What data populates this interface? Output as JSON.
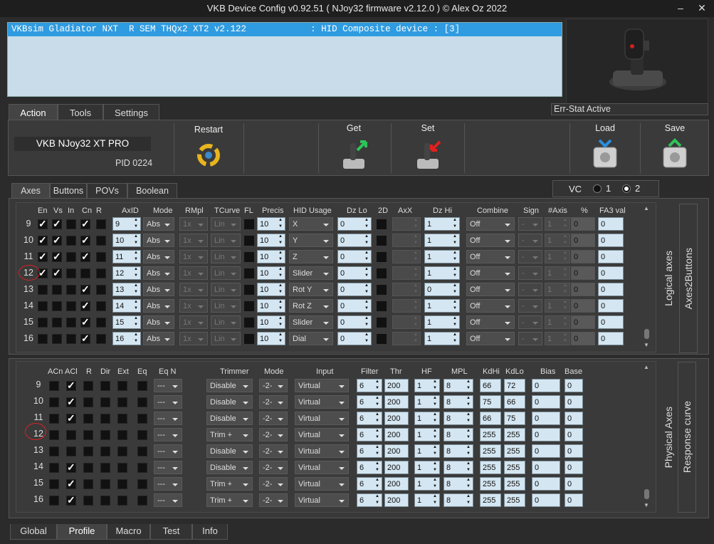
{
  "window": {
    "title": "VKB Device Config v0.92.51 ( NJoy32 firmware v2.12.0 ) © Alex Oz 2022",
    "min": "–",
    "close": "✕"
  },
  "device_list": {
    "selected": "VKBsim Gladiator NXT  R SEM THQx2 XT2 v2.122            : HID Composite device : [3]"
  },
  "err_stat": "Err-Stat Active",
  "main_tabs": [
    "Action",
    "Tools",
    "Settings"
  ],
  "toolbar": {
    "device_name": "VKB NJoy32 XT PRO",
    "pid": "PID 0224",
    "restart": "Restart",
    "get": "Get",
    "set": "Set",
    "load": "Load",
    "save": "Save"
  },
  "sub_tabs": [
    "Axes",
    "Buttons",
    "POVs",
    "Boolean"
  ],
  "vc": {
    "label": "VC",
    "opt1": "1",
    "opt2": "2"
  },
  "logical": {
    "side_labels": [
      "Logical axes",
      "Axes2Buttons"
    ],
    "headers": [
      "En",
      "Vs",
      "In",
      "Cn",
      "R",
      "AxID",
      "Mode",
      "RMpl",
      "TCurve",
      "FL",
      "Precis",
      "HID Usage",
      "Dz Lo",
      "2D",
      "AxX",
      "Dz Hi",
      "Combine",
      "Sign",
      "#Axis",
      "%",
      "FA3 val"
    ],
    "rows": [
      {
        "n": "9",
        "en": true,
        "vs": true,
        "in": false,
        "cn": true,
        "axid": "9",
        "mode": "Abs",
        "rmpl": "1x",
        "tc": "Lin",
        "prec": "10",
        "hid": "X",
        "dzlo": "0",
        "dzhi": "1",
        "comb": "Off",
        "sign": "-",
        "axis": "1",
        "pct": "0",
        "fa3": "0"
      },
      {
        "n": "10",
        "en": true,
        "vs": true,
        "in": false,
        "cn": true,
        "axid": "10",
        "mode": "Abs",
        "rmpl": "1x",
        "tc": "Lin",
        "prec": "10",
        "hid": "Y",
        "dzlo": "0",
        "dzhi": "1",
        "comb": "Off",
        "sign": "-",
        "axis": "1",
        "pct": "0",
        "fa3": "0"
      },
      {
        "n": "11",
        "en": true,
        "vs": true,
        "in": false,
        "cn": true,
        "axid": "11",
        "mode": "Abs",
        "rmpl": "1x",
        "tc": "Lin",
        "prec": "10",
        "hid": "Z",
        "dzlo": "0",
        "dzhi": "1",
        "comb": "Off",
        "sign": "-",
        "axis": "1",
        "pct": "0",
        "fa3": "0"
      },
      {
        "n": "12",
        "en": true,
        "vs": true,
        "in": false,
        "cn": false,
        "axid": "12",
        "mode": "Abs",
        "rmpl": "1x",
        "tc": "Lin",
        "prec": "10",
        "hid": "Slider",
        "dzlo": "0",
        "dzhi": "1",
        "comb": "Off",
        "sign": "-",
        "axis": "1",
        "pct": "0",
        "fa3": "0"
      },
      {
        "n": "13",
        "en": false,
        "vs": false,
        "in": false,
        "cn": true,
        "axid": "13",
        "mode": "Abs",
        "rmpl": "1x",
        "tc": "Lin",
        "prec": "10",
        "hid": "Rot Y",
        "dzlo": "0",
        "dzhi": "0",
        "comb": "Off",
        "sign": "-",
        "axis": "1",
        "pct": "0",
        "fa3": "0"
      },
      {
        "n": "14",
        "en": false,
        "vs": false,
        "in": false,
        "cn": true,
        "axid": "14",
        "mode": "Abs",
        "rmpl": "1x",
        "tc": "Lin",
        "prec": "10",
        "hid": "Rot Z",
        "dzlo": "0",
        "dzhi": "1",
        "comb": "Off",
        "sign": "-",
        "axis": "1",
        "pct": "0",
        "fa3": "0"
      },
      {
        "n": "15",
        "en": false,
        "vs": false,
        "in": false,
        "cn": true,
        "axid": "15",
        "mode": "Abs",
        "rmpl": "1x",
        "tc": "Lin",
        "prec": "10",
        "hid": "Slider",
        "dzlo": "0",
        "dzhi": "1",
        "comb": "Off",
        "sign": "-",
        "axis": "1",
        "pct": "0",
        "fa3": "0"
      },
      {
        "n": "16",
        "en": false,
        "vs": false,
        "in": false,
        "cn": true,
        "axid": "16",
        "mode": "Abs",
        "rmpl": "1x",
        "tc": "Lin",
        "prec": "10",
        "hid": "Dial",
        "dzlo": "0",
        "dzhi": "1",
        "comb": "Off",
        "sign": "-",
        "axis": "1",
        "pct": "0",
        "fa3": "0"
      }
    ]
  },
  "physical": {
    "side_labels": [
      "Physical Axes",
      "Response curve"
    ],
    "headers": [
      "ACn",
      "ACl",
      "R",
      "Dir",
      "Ext",
      "Eq",
      "Eq N",
      "Trimmer",
      "Mode",
      "Input",
      "Filter",
      "Thr",
      "HF",
      "MPL",
      "KdHi",
      "KdLo",
      "Bias",
      "Base"
    ],
    "rows": [
      {
        "n": "9",
        "acl": true,
        "eqn": "---",
        "trim": "Disable",
        "mode": "-2-",
        "input": "Virtual",
        "filter": "6",
        "thr": "200",
        "hf": "1",
        "mpl": "8",
        "kdhi": "66",
        "kdlo": "72",
        "bias": "0",
        "base": "0"
      },
      {
        "n": "10",
        "acl": true,
        "eqn": "---",
        "trim": "Disable",
        "mode": "-2-",
        "input": "Virtual",
        "filter": "6",
        "thr": "200",
        "hf": "1",
        "mpl": "8",
        "kdhi": "75",
        "kdlo": "66",
        "bias": "0",
        "base": "0"
      },
      {
        "n": "11",
        "acl": true,
        "eqn": "---",
        "trim": "Disable",
        "mode": "-2-",
        "input": "Virtual",
        "filter": "6",
        "thr": "200",
        "hf": "1",
        "mpl": "8",
        "kdhi": "66",
        "kdlo": "75",
        "bias": "0",
        "base": "0"
      },
      {
        "n": "12",
        "acl": false,
        "eqn": "---",
        "trim": "Trim +",
        "mode": "-2-",
        "input": "Virtual",
        "filter": "6",
        "thr": "200",
        "hf": "1",
        "mpl": "8",
        "kdhi": "255",
        "kdlo": "255",
        "bias": "0",
        "base": "0"
      },
      {
        "n": "13",
        "acl": false,
        "eqn": "---",
        "trim": "Disable",
        "mode": "-2-",
        "input": "Virtual",
        "filter": "6",
        "thr": "200",
        "hf": "1",
        "mpl": "8",
        "kdhi": "255",
        "kdlo": "255",
        "bias": "0",
        "base": "0"
      },
      {
        "n": "14",
        "acl": true,
        "eqn": "---",
        "trim": "Disable",
        "mode": "-2-",
        "input": "Virtual",
        "filter": "6",
        "thr": "200",
        "hf": "1",
        "mpl": "8",
        "kdhi": "255",
        "kdlo": "255",
        "bias": "0",
        "base": "0"
      },
      {
        "n": "15",
        "acl": true,
        "eqn": "---",
        "trim": "Trim +",
        "mode": "-2-",
        "input": "Virtual",
        "filter": "6",
        "thr": "200",
        "hf": "1",
        "mpl": "8",
        "kdhi": "255",
        "kdlo": "255",
        "bias": "0",
        "base": "0"
      },
      {
        "n": "16",
        "acl": true,
        "eqn": "---",
        "trim": "Trim +",
        "mode": "-2-",
        "input": "Virtual",
        "filter": "6",
        "thr": "200",
        "hf": "1",
        "mpl": "8",
        "kdhi": "255",
        "kdlo": "255",
        "bias": "0",
        "base": "0"
      }
    ]
  },
  "bottom_tabs": [
    "Global",
    "Profile",
    "Macro",
    "Test",
    "Info"
  ],
  "colors": {
    "selection": "#2f9be0",
    "field": "#d4e6f1",
    "annotation": "#dd2222"
  }
}
